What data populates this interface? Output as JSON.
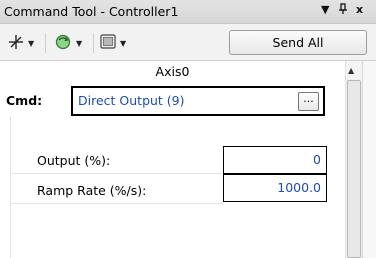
{
  "window": {
    "title": "Command Tool - Controller1",
    "menu_glyph": "▼",
    "pin_glyph": "ᵽ",
    "close_glyph": "x"
  },
  "toolbar": {
    "send_all_label": "Send All",
    "icons": [
      "axes-icon",
      "enable-icon",
      "function-key-icon"
    ]
  },
  "panel": {
    "axis_title": "Axis0",
    "cmd_label": "Cmd:",
    "cmd_value": "Direct Output (9)",
    "browse_label": "...",
    "rows": [
      {
        "label": "Output (%):",
        "value": "0"
      },
      {
        "label": "Ramp Rate (%/s):",
        "value": "1000.0"
      }
    ]
  },
  "colors": {
    "value_text": "#1e4cb4",
    "titlebar": "#dcdcdc"
  }
}
